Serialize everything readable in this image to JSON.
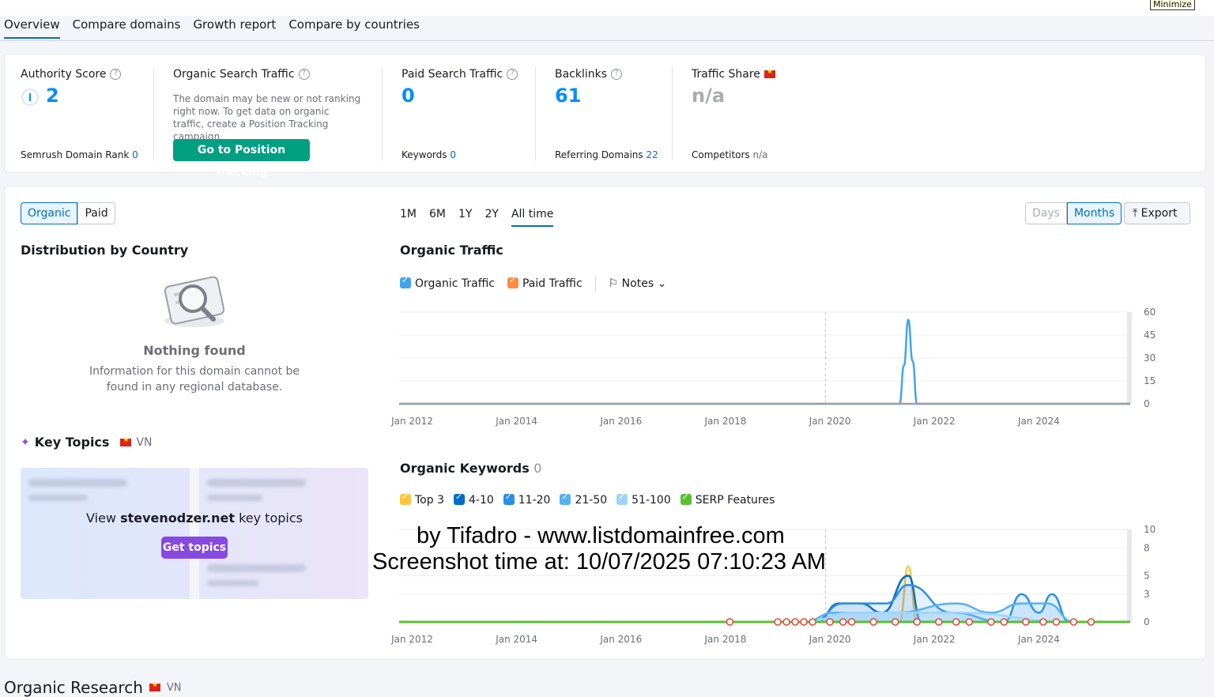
{
  "window": {
    "minimize_label": "Minimize"
  },
  "nav": {
    "tabs": [
      "Overview",
      "Compare domains",
      "Growth report",
      "Compare by countries"
    ]
  },
  "metrics": {
    "authority": {
      "label": "Authority Score",
      "value": "2",
      "sub_label": "Semrush Domain Rank",
      "sub_value": "0"
    },
    "organic": {
      "label": "Organic Search Traffic",
      "note": "The domain may be new or not ranking right now. To get data on organic traffic, create a Position Tracking campaign.",
      "button": "Go to Position Tracking"
    },
    "paid": {
      "label": "Paid Search Traffic",
      "value": "0",
      "sub_label": "Keywords",
      "sub_value": "0"
    },
    "backlinks": {
      "label": "Backlinks",
      "value": "61",
      "sub_label": "Referring Domains",
      "sub_value": "22"
    },
    "share": {
      "label": "Traffic Share",
      "value": "n/a",
      "sub_label": "Competitors",
      "sub_value": "n/a"
    }
  },
  "toggle": {
    "organic": "Organic",
    "paid": "Paid"
  },
  "distribution": {
    "title": "Distribution by Country",
    "empty_title": "Nothing found",
    "empty_desc": "Information for this domain cannot be found in any regional database."
  },
  "key_topics": {
    "title": "Key Topics",
    "country": "VN",
    "prompt_prefix": "View ",
    "domain": "stevenodzer.net",
    "prompt_suffix": " key topics",
    "button": "Get topics"
  },
  "periods": [
    "1M",
    "6M",
    "1Y",
    "2Y",
    "All time"
  ],
  "granularity": {
    "days": "Days",
    "months": "Months"
  },
  "export_label": "Export",
  "traffic": {
    "title": "Organic Traffic",
    "legend_organic": "Organic Traffic",
    "legend_paid": "Paid Traffic",
    "notes": "Notes"
  },
  "keywords": {
    "title": "Organic Keywords",
    "count": "0",
    "legend": [
      "Top 3",
      "4-10",
      "11-20",
      "21-50",
      "51-100",
      "SERP Features"
    ]
  },
  "watermark": {
    "line1": "by Tifadro - www.listdomainfree.com",
    "line2": "Screenshot time at: 10/07/2025 07:10:23 AM"
  },
  "bottom": {
    "title": "Organic Research",
    "country": "VN"
  },
  "colors": {
    "accent": "#006dca",
    "value_blue": "#008ff8",
    "green_button": "#009f81",
    "purple_button": "#8649e1",
    "organic_line": "#41a5ee",
    "top3": "#ffc53d",
    "serp": "#59c130"
  },
  "chart_data": [
    {
      "type": "line",
      "title": "Organic Traffic",
      "x_ticks": [
        "Jan 2012",
        "Jan 2014",
        "Jan 2016",
        "Jan 2018",
        "Jan 2020",
        "Jan 2022",
        "Jan 2024"
      ],
      "y_ticks": [
        0,
        15,
        30,
        45,
        60
      ],
      "ylim": [
        0,
        60
      ],
      "xlim": [
        "2011-10",
        "2025-10"
      ],
      "grid": true,
      "series": [
        {
          "name": "Organic Traffic",
          "points": [
            [
              "2011-10",
              0
            ],
            [
              "2021-05",
              0
            ],
            [
              "2021-06",
              25
            ],
            [
              "2021-07",
              55
            ],
            [
              "2021-08",
              28
            ],
            [
              "2021-09",
              0
            ],
            [
              "2025-10",
              0
            ]
          ]
        },
        {
          "name": "Paid Traffic",
          "points": [
            [
              "2011-10",
              0
            ],
            [
              "2025-10",
              0
            ]
          ]
        }
      ]
    },
    {
      "type": "area",
      "title": "Organic Keywords",
      "x_ticks": [
        "Jan 2012",
        "Jan 2014",
        "Jan 2016",
        "Jan 2018",
        "Jan 2020",
        "Jan 2022",
        "Jan 2024"
      ],
      "y_ticks": [
        0,
        3,
        5,
        8,
        10
      ],
      "ylim": [
        0,
        10
      ],
      "xlim": [
        "2011-10",
        "2025-10"
      ],
      "grid": true,
      "series": [
        {
          "name": "Top 3",
          "points": [
            [
              "2021-05",
              0
            ],
            [
              "2021-07",
              6
            ],
            [
              "2021-09",
              0
            ]
          ]
        },
        {
          "name": "4-10",
          "points": [
            [
              "2019-10",
              0
            ],
            [
              "2020-03",
              2
            ],
            [
              "2020-08",
              2
            ],
            [
              "2021-01",
              1
            ],
            [
              "2021-07",
              5
            ],
            [
              "2021-10",
              0
            ]
          ]
        },
        {
          "name": "11-20",
          "points": [
            [
              "2019-09",
              0
            ],
            [
              "2020-04",
              2
            ],
            [
              "2021-02",
              2
            ],
            [
              "2021-07",
              4
            ],
            [
              "2022-05",
              1
            ],
            [
              "2023-05",
              0
            ],
            [
              "2023-09",
              3
            ],
            [
              "2024-01",
              1
            ],
            [
              "2024-04",
              3
            ],
            [
              "2024-08",
              0
            ]
          ]
        },
        {
          "name": "21-50",
          "points": [
            [
              "2019-07",
              0
            ],
            [
              "2020-02",
              1
            ],
            [
              "2021-04",
              1
            ],
            [
              "2022-06",
              2
            ],
            [
              "2023-02",
              1
            ],
            [
              "2023-09",
              2
            ],
            [
              "2024-03",
              2
            ],
            [
              "2024-09",
              0
            ]
          ]
        },
        {
          "name": "51-100",
          "points": [
            [
              "2019-07",
              0
            ],
            [
              "2020-06",
              1
            ],
            [
              "2022-06",
              1
            ],
            [
              "2024-09",
              0
            ]
          ]
        }
      ]
    }
  ]
}
